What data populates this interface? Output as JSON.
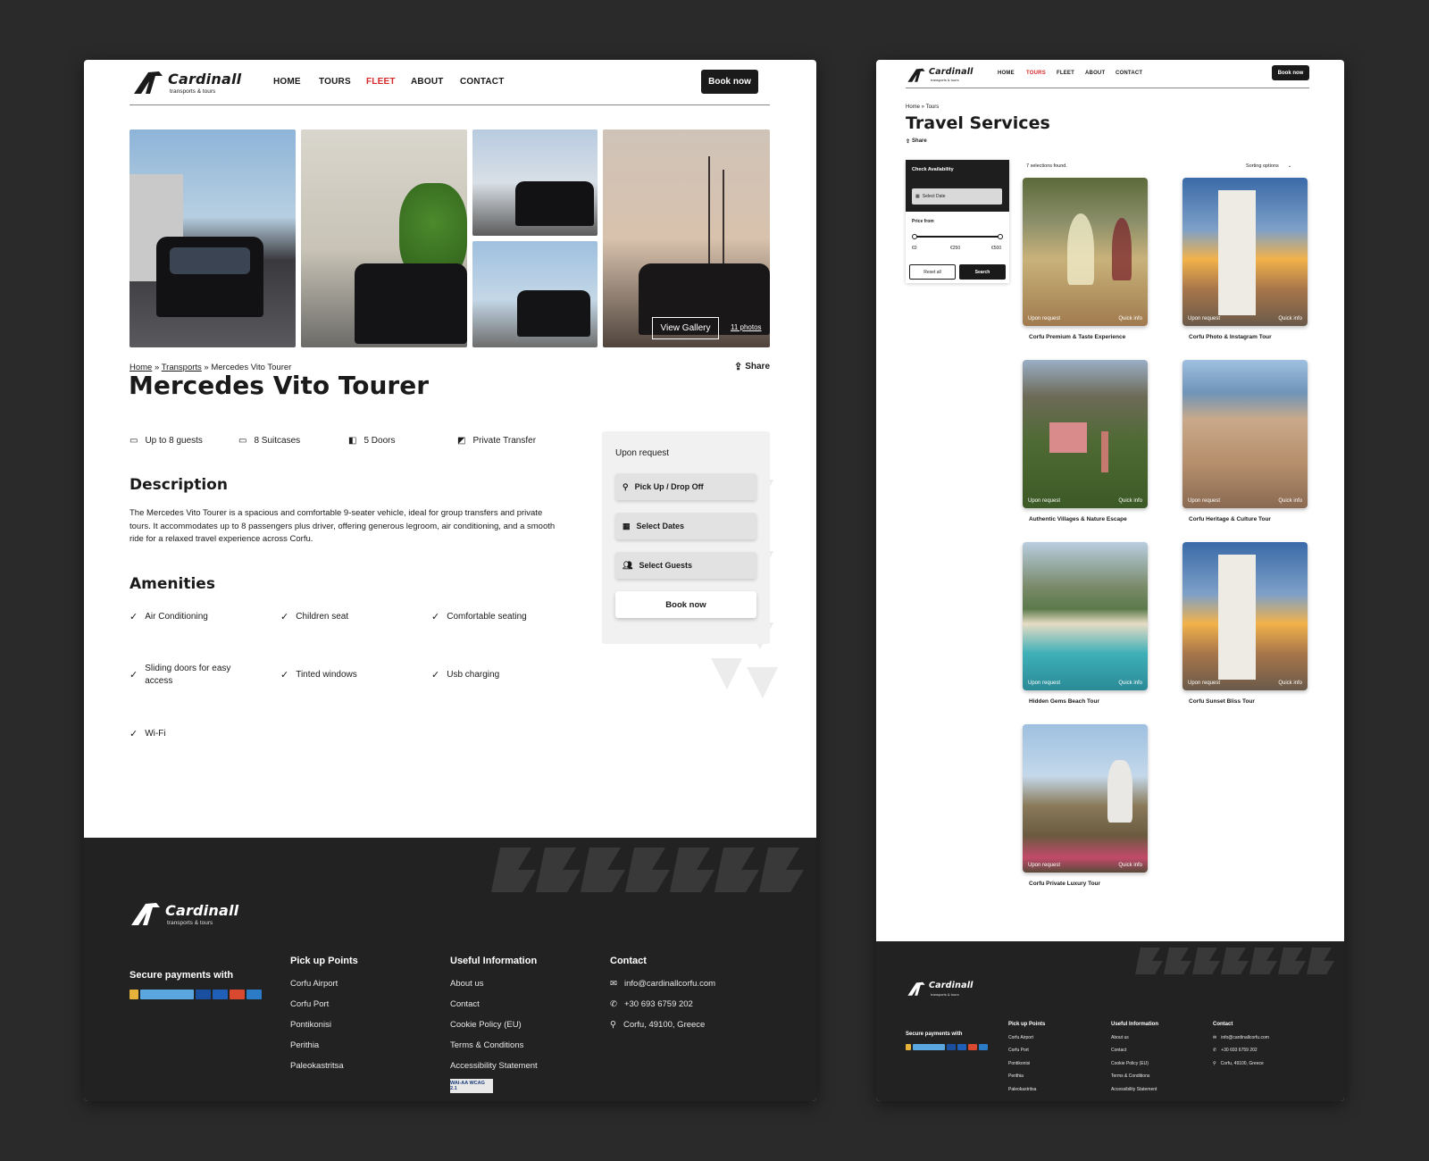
{
  "left": {
    "brand": {
      "name": "Cardinall",
      "tagline": "transports & tours"
    },
    "nav": [
      "HOME",
      "TOURS",
      "FLEET",
      "ABOUT",
      "CONTACT"
    ],
    "nav_active": "FLEET",
    "book_now": "Book now",
    "gallery": {
      "view": "View Gallery",
      "count": "11 photos"
    },
    "breadcrumb": {
      "home": "Home",
      "sep1": " » ",
      "section": "Transports",
      "sep2": " » ",
      "current": "Mercedes Vito Tourer"
    },
    "share": "Share",
    "title": "Mercedes Vito Tourer",
    "specs": [
      "Up to 8 guests",
      "8 Suitcases",
      "5 Doors",
      "Private Transfer"
    ],
    "description_heading": "Description",
    "description": "The Mercedes Vito Tourer is a spacious and comfortable 9-seater vehicle, ideal for group transfers and private tours. It accommodates up to 8 passengers plus driver, offering generous legroom, air conditioning, and a smooth ride for a relaxed travel experience across Corfu.",
    "amenities_heading": "Amenities",
    "amenities": [
      "Air Conditioning",
      "Children seat",
      "Comfortable seating",
      "Sliding doors for easy access",
      "Tinted windows",
      "Usb charging",
      "Wi-Fi"
    ],
    "booking": {
      "price": "Upon request",
      "pickup": "Pick Up / Drop Off",
      "dates": "Select Dates",
      "guests": "Select Guests",
      "button": "Book now"
    },
    "footer": {
      "secure": "Secure payments with",
      "pickup_heading": "Pick up Points",
      "pickup": [
        "Corfu Airport",
        "Corfu Port",
        "Pontikonisi",
        "Perithia",
        "Paleokastritsa"
      ],
      "info_heading": "Useful Information",
      "info": [
        "About us",
        "Contact",
        "Cookie Policy (EU)",
        "Terms & Conditions",
        "Accessibility Statement"
      ],
      "contact_heading": "Contact",
      "email": "info@cardinallcorfu.com",
      "phone": "+30 693 6759 202",
      "address": "Corfu, 49100, Greece",
      "wcag": "WAI-AA WCAG 2.1"
    }
  },
  "right": {
    "brand": {
      "name": "Cardinall",
      "tagline": "transports & tours"
    },
    "nav": [
      "HOME",
      "TOURS",
      "FLEET",
      "ABOUT",
      "CONTACT"
    ],
    "nav_active": "TOURS",
    "book_now": "Book now",
    "breadcrumb": "Home » Tours",
    "title": "Travel Services",
    "share": "Share",
    "filter": {
      "heading": "Check Availability",
      "date": "Select Date",
      "price_label": "Price from",
      "min": "€0",
      "mid": "€250",
      "max": "€500",
      "reset": "Reset all",
      "search": "Search"
    },
    "found": "7 selections found.",
    "sorting": "Sorting options",
    "tag_left": "Upon request",
    "tag_right": "Quick info",
    "cards": [
      "Corfu Premium & Taste Experience",
      "Corfu Photo & Instagram Tour",
      "Authentic Villages & Nature Escape",
      "Corfu Heritage & Culture Tour",
      "Hidden Gems Beach Tour",
      "Corfu Sunset Bliss Tour",
      "Corfu Private Luxury Tour"
    ],
    "footer": {
      "secure": "Secure payments with",
      "pickup_heading": "Pick up Points",
      "pickup": [
        "Corfu Airport",
        "Corfu Port",
        "Pontikonisi",
        "Perithia",
        "Paleokastritsa"
      ],
      "info_heading": "Useful Information",
      "info": [
        "About us",
        "Contact",
        "Cookie Policy (EU)",
        "Terms & Conditions",
        "Accessibility Statement"
      ],
      "contact_heading": "Contact",
      "email": "info@cardinallcorfu.com",
      "phone": "+30 693 6759 202",
      "address": "Corfu, 49100, Greece"
    }
  }
}
